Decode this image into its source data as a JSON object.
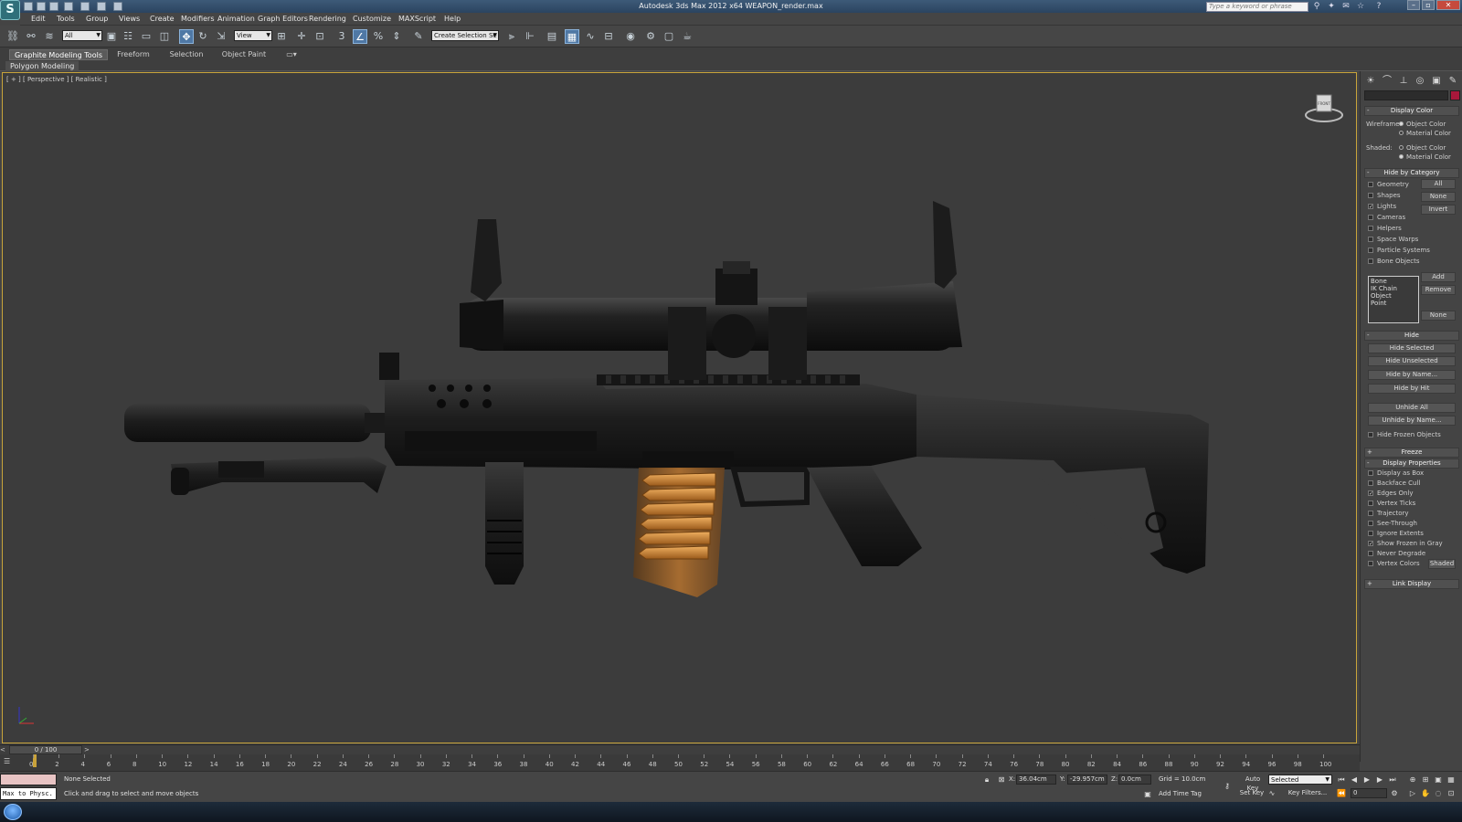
{
  "window": {
    "title": "Autodesk 3ds Max  2012 x64     WEAPON_render.max",
    "app_logo_letter": "S",
    "search_placeholder": "Type a keyword or phrase"
  },
  "menu": [
    "Edit",
    "Tools",
    "Group",
    "Views",
    "Create",
    "Modifiers",
    "Animation",
    "Graph Editors",
    "Rendering",
    "Customize",
    "MAXScript",
    "Help"
  ],
  "toolbar": {
    "selection_filter": "All",
    "reference_coord": "View",
    "named_selection": "Create Selection Se"
  },
  "ribbon": {
    "tabs": [
      "Graphite Modeling Tools",
      "Freeform",
      "Selection",
      "Object Paint"
    ],
    "active_tab": 0,
    "panel_label": "Polygon Modeling"
  },
  "viewport": {
    "label": "[ + ] [ Perspective ] [ Realistic ]",
    "viewcube_label": "FRONT"
  },
  "command_panel": {
    "display_color": {
      "title": "Display Color",
      "wireframe_label": "Wireframe:",
      "shaded_label": "Shaded:",
      "object_color": "Object Color",
      "material_color": "Material Color",
      "wireframe_selected": "Object Color",
      "shaded_selected": "Material Color"
    },
    "hide_by_category": {
      "title": "Hide by Category",
      "items": [
        {
          "label": "Geometry",
          "checked": false
        },
        {
          "label": "Shapes",
          "checked": false
        },
        {
          "label": "Lights",
          "checked": true
        },
        {
          "label": "Cameras",
          "checked": false
        },
        {
          "label": "Helpers",
          "checked": false
        },
        {
          "label": "Space Warps",
          "checked": false
        },
        {
          "label": "Particle Systems",
          "checked": false
        },
        {
          "label": "Bone Objects",
          "checked": false
        }
      ],
      "all_btn": "All",
      "none_btn": "None",
      "invert_btn": "Invert",
      "list": [
        "Bone",
        "IK Chain Object",
        "Point"
      ],
      "add_btn": "Add",
      "remove_btn": "Remove",
      "none2_btn": "None"
    },
    "hide": {
      "title": "Hide",
      "buttons": [
        "Hide Selected",
        "Hide Unselected",
        "Hide by Name...",
        "Hide by Hit",
        "Unhide All",
        "Unhide by Name..."
      ],
      "hide_frozen": "Hide Frozen Objects"
    },
    "freeze_title": "Freeze",
    "display_properties": {
      "title": "Display Properties",
      "items": [
        {
          "label": "Display as Box",
          "checked": false
        },
        {
          "label": "Backface Cull",
          "checked": false
        },
        {
          "label": "Edges Only",
          "checked": true
        },
        {
          "label": "Vertex Ticks",
          "checked": false
        },
        {
          "label": "Trajectory",
          "checked": false
        },
        {
          "label": "See-Through",
          "checked": false
        },
        {
          "label": "Ignore Extents",
          "checked": false
        },
        {
          "label": "Show Frozen in Gray",
          "checked": true
        },
        {
          "label": "Never Degrade",
          "checked": false
        },
        {
          "label": "Vertex Colors",
          "checked": false
        }
      ],
      "shaded_btn": "Shaded"
    },
    "link_display_title": "Link Display"
  },
  "timeline": {
    "frame_display": "0 / 100",
    "ticks": [
      "0",
      "2",
      "4",
      "6",
      "8",
      "10",
      "12",
      "14",
      "16",
      "18",
      "20",
      "22",
      "24",
      "26",
      "28",
      "30",
      "32",
      "34",
      "36",
      "38",
      "40",
      "42",
      "44",
      "46",
      "48",
      "50",
      "52",
      "54",
      "56",
      "58",
      "60",
      "62",
      "64",
      "66",
      "68",
      "70",
      "72",
      "74",
      "76",
      "78",
      "80",
      "82",
      "84",
      "86",
      "88",
      "90",
      "92",
      "94",
      "96",
      "98",
      "100"
    ]
  },
  "status": {
    "maxscript_listener": "Max to Physc.",
    "selection_status": "None Selected",
    "prompt": "Click and drag to select and move objects",
    "x_label": "X:",
    "x_value": "36.04cm",
    "y_label": "Y:",
    "y_value": "-29.957cm",
    "z_label": "Z:",
    "z_value": "0.0cm",
    "grid": "Grid = 10.0cm",
    "add_time_tag": "Add Time Tag",
    "auto_key": "Auto Key",
    "selected_dropdown": "Selected",
    "set_key": "Set Key",
    "key_filters": "Key Filters...",
    "current_frame": "0"
  },
  "colors": {
    "viewport_bg": "#3c3c3c",
    "viewport_border": "#c8a43a",
    "object_color_swatch": "#a8183b",
    "active_tool": "#4f78a5"
  }
}
